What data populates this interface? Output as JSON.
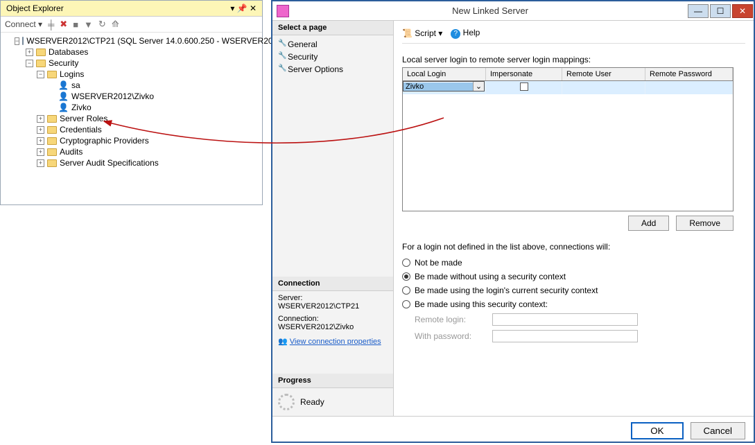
{
  "objectExplorer": {
    "title": "Object Explorer",
    "connect": "Connect",
    "tree": {
      "server": "WSERVER2012\\CTP21 (SQL Server 14.0.600.250 - WSERVER20",
      "databases": "Databases",
      "security": "Security",
      "logins": "Logins",
      "loginItems": [
        "sa",
        "WSERVER2012\\Zivko",
        "Zivko"
      ],
      "serverRoles": "Server Roles",
      "credentials": "Credentials",
      "cryptoProviders": "Cryptographic Providers",
      "audits": "Audits",
      "auditSpecs": "Server Audit Specifications"
    }
  },
  "dialog": {
    "title": "New Linked Server",
    "selectPage": "Select a page",
    "pages": [
      "General",
      "Security",
      "Server Options"
    ],
    "script": "Script",
    "help": "Help",
    "mapLabel": "Local server login to remote server login mappings:",
    "gridHeaders": {
      "h1": "Local Login",
      "h2": "Impersonate",
      "h3": "Remote User",
      "h4": "Remote Password"
    },
    "gridRow": {
      "localLogin": "Zivko",
      "impersonate": false,
      "remoteUser": "",
      "remotePassword": ""
    },
    "addBtn": "Add",
    "removeBtn": "Remove",
    "notDefinedLabel": "For a login not defined in the list above, connections will:",
    "radios": {
      "r1": "Not be made",
      "r2": "Be made without using a security context",
      "r3": "Be made using the login's current security context",
      "r4": "Be made using this security context:"
    },
    "selectedRadio": "r2",
    "remoteLoginLabel": "Remote login:",
    "withPasswordLabel": "With password:",
    "remoteLoginValue": "",
    "withPasswordValue": "",
    "ok": "OK",
    "cancel": "Cancel",
    "connection": {
      "header": "Connection",
      "serverLabel": "Server:",
      "server": "WSERVER2012\\CTP21",
      "connectionLabel": "Connection:",
      "connection": "WSERVER2012\\Zivko",
      "viewProps": "View connection properties"
    },
    "progress": {
      "header": "Progress",
      "status": "Ready"
    }
  }
}
